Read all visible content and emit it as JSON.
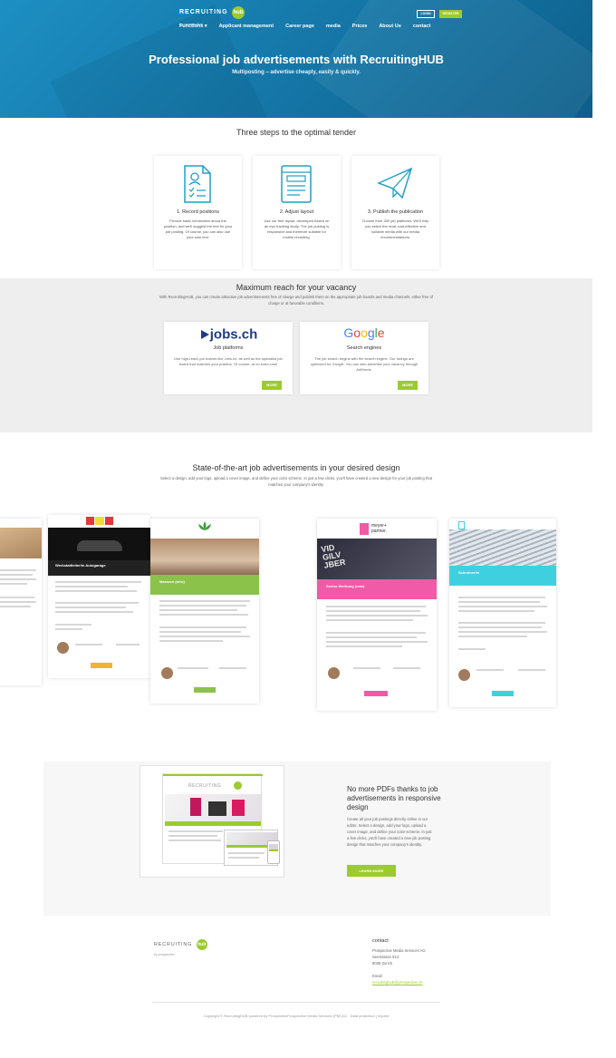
{
  "header": {
    "logo_word": "RECRUITING",
    "logo_hub": "hub",
    "logo_by": "by prospective",
    "login_label": "LOGIN",
    "register_label": "REGISTER",
    "nav": [
      "Functions ▾",
      "Applicant management",
      "Career page",
      "media",
      "Prices",
      "About Us",
      "contact"
    ]
  },
  "hero": {
    "title": "Professional job advertisements with RecruitingHUB",
    "subtitle": "Multiposting – advertise cheaply, easily & quickly."
  },
  "steps": {
    "title": "Three steps to the optimal tender",
    "items": [
      {
        "icon": "document-check-icon",
        "title": "1. Record positions",
        "text": "Provide basic information about the position, and we'll suggest the text for your job posting. Of course, you can also use your own text."
      },
      {
        "icon": "layout-icon",
        "title": "2. Adjust layout",
        "text": "Use our free layout, developed based on an eye-tracking study. The job posting is responsive and therefore suitable for mobile recruiting."
      },
      {
        "icon": "paper-plane-icon",
        "title": "3. Publish the publication",
        "text": "Choose from 300 job platforms. We'll help you select the most cost-effective and suitable media with our media recommendations."
      }
    ]
  },
  "reach": {
    "title": "Maximum reach for your vacancy",
    "text": "With RecruitingHUB, you can create attractive job advertisements free of charge and publish them on the appropriate job boards and media channels, either free of charge or at favorable conditions.",
    "cards": [
      {
        "logo": "jobs.ch",
        "title": "Job platforms",
        "text": "Use high-reach job boards like Jobs.ch, as well as the specialist job board that matches your position. Of course, at no extra cost!",
        "button": "MORE"
      },
      {
        "logo": "Google",
        "title": "Search engines",
        "text": "The job search begins with the search engine. Our listings are optimized for Google. You can also advertise your vacancy through AdWords.",
        "button": "MORE"
      }
    ]
  },
  "design": {
    "title": "State-of-the-art job advertisements in your desired design",
    "text": "Select a design, add your logo, upload a cover image, and define your color scheme. In just a few clicks, you'll have created a new design for your job posting that matches your company's identity.",
    "samples": [
      {
        "header_title": "Werkstattleiter/in Autogarage",
        "accent": "#f3b233"
      },
      {
        "header_title": "Masseur (m/w)",
        "accent": "#8bc34a"
      },
      {
        "header_title": "Senior Werbung (m/w)",
        "accent": "#f05aa7"
      },
      {
        "header_title": "Schreiner/in",
        "accent": "#3fd0e0"
      }
    ]
  },
  "pdf": {
    "title": "No more PDFs thanks to job advertisements in responsive design",
    "text": "Create all your job postings directly online in our editor. Select a design, add your logo, upload a cover image, and define your color scheme. In just a few clicks, you'll have created a new job posting design that matches your company's identity.",
    "button": "LEARN MORE",
    "preview_logo": "RECRUITING"
  },
  "footer": {
    "logo_word": "RECRUITING",
    "logo_hub": "hub",
    "logo_by": "by prospective",
    "contact_title": "contact",
    "address": [
      "Prospective Media Services AG",
      "Seestrasse 513",
      "8038 Zurich"
    ],
    "email_label": "Email:",
    "email": "recruitinghub@prospective.ch",
    "copyright": "Copyright © RecruitingHUB powered by ProspectiveProspective Media Services (PM) AG · Data protection | Imprint"
  },
  "colors": {
    "accent": "#9bcb2c",
    "hero": "#1577a8",
    "icon": "#1ea0c7"
  }
}
